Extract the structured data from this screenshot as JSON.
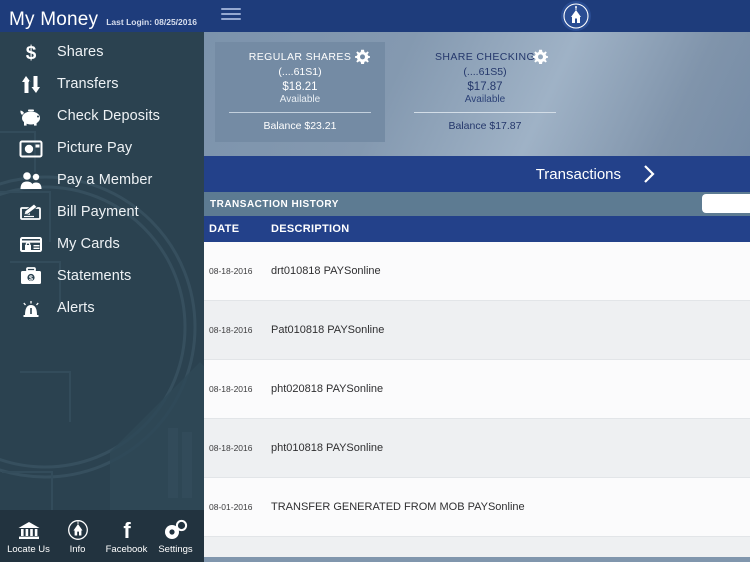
{
  "header": {
    "app_title": "My Money",
    "last_login": "Last Login: 08/25/2016",
    "menu_icon": "hamburger-icon",
    "logo_icon": "credit-union-logo-icon"
  },
  "sidebar": {
    "items": [
      {
        "label": "Shares",
        "icon": "dollar-sign-icon"
      },
      {
        "label": "Transfers",
        "icon": "transfer-arrows-icon"
      },
      {
        "label": "Check Deposits",
        "icon": "piggy-bank-icon"
      },
      {
        "label": "Picture Pay",
        "icon": "camera-icon"
      },
      {
        "label": "Pay a Member",
        "icon": "two-people-icon"
      },
      {
        "label": "Bill Payment",
        "icon": "check-pen-icon"
      },
      {
        "label": "My Cards",
        "icon": "card-lock-icon"
      },
      {
        "label": "Statements",
        "icon": "briefcase-dollar-icon"
      },
      {
        "label": "Alerts",
        "icon": "alarm-bell-icon"
      }
    ]
  },
  "bottom_nav": {
    "items": [
      {
        "label": "Locate Us",
        "icon": "bank-building-icon"
      },
      {
        "label": "Info",
        "icon": "info-logo-icon"
      },
      {
        "label": "Facebook",
        "icon": "facebook-f-icon"
      },
      {
        "label": "Settings",
        "icon": "gears-icon"
      }
    ]
  },
  "accounts": [
    {
      "name": "REGULAR SHARES",
      "number": "(....61S1)",
      "amount": "$18.21",
      "available_label": "Available",
      "balance": "Balance $23.21",
      "selected": true,
      "gear_icon": "gear-icon"
    },
    {
      "name": "SHARE CHECKING",
      "number": "(....61S5)",
      "amount": "$17.87",
      "available_label": "Available",
      "balance": "Balance $17.87",
      "selected": false,
      "gear_icon": "gear-icon"
    }
  ],
  "transactions_bar": {
    "label": "Transactions",
    "chevron_icon": "chevron-right-icon"
  },
  "transaction_history": {
    "title": "TRANSACTION HISTORY",
    "search_placeholder": "",
    "search_icon": "search-icon",
    "columns": {
      "date": "DATE",
      "description": "DESCRIPTION"
    },
    "rows": [
      {
        "date": "08-18-2016",
        "description": "drt010818 PAYSonline"
      },
      {
        "date": "08-18-2016",
        "description": "Pat010818 PAYSonline"
      },
      {
        "date": "08-18-2016",
        "description": "pht020818 PAYSonline"
      },
      {
        "date": "08-18-2016",
        "description": "pht010818 PAYSonline"
      },
      {
        "date": "08-01-2016",
        "description": "TRANSFER GENERATED FROM MOB PAYSonline"
      }
    ]
  },
  "colors": {
    "navy": "#1e3c7b",
    "bar_navy": "#23418a",
    "sidebar": "#2b4250",
    "panel_steel": "#8096ad",
    "history_bar": "#5d7b92"
  }
}
